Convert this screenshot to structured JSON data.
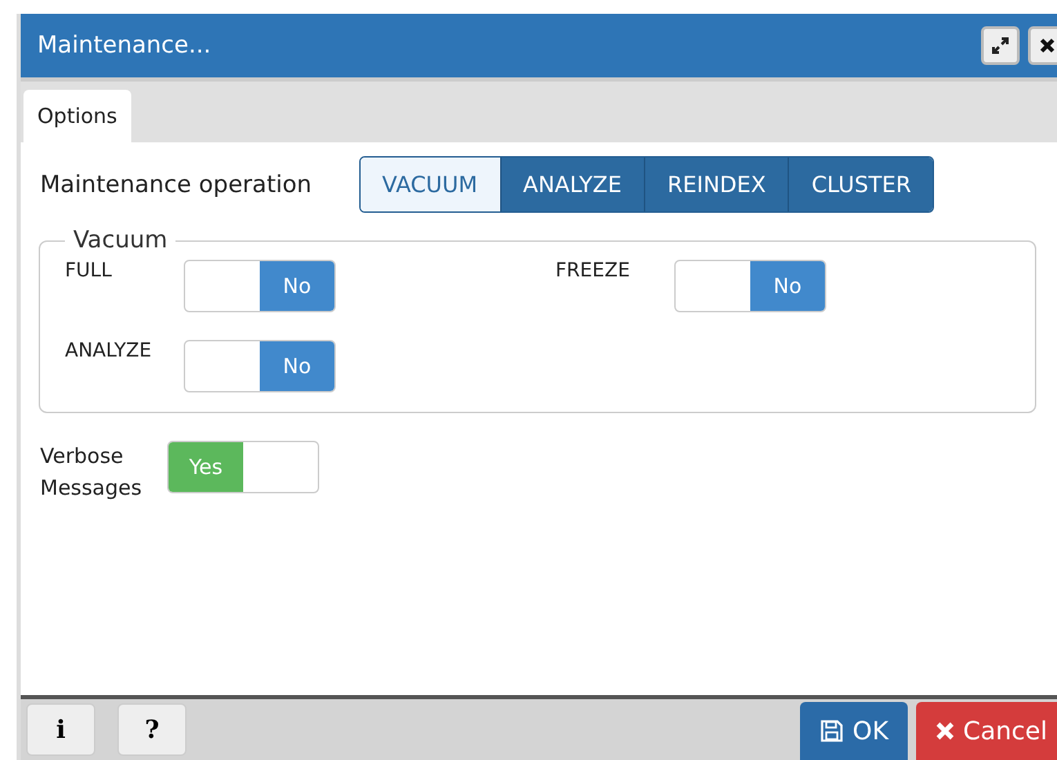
{
  "window": {
    "title": "Maintenance..."
  },
  "tabs": [
    {
      "label": "Options",
      "selected": true
    }
  ],
  "operation": {
    "label": "Maintenance operation",
    "options": [
      {
        "label": "VACUUM",
        "selected": true
      },
      {
        "label": "ANALYZE",
        "selected": false
      },
      {
        "label": "REINDEX",
        "selected": false
      },
      {
        "label": "CLUSTER",
        "selected": false
      }
    ]
  },
  "vacuum": {
    "legend": "Vacuum",
    "switches": [
      {
        "label": "FULL",
        "on": false,
        "text": "No"
      },
      {
        "label": "FREEZE",
        "on": false,
        "text": "No"
      },
      {
        "label": "ANALYZE",
        "on": false,
        "text": "No"
      }
    ]
  },
  "verbose": {
    "label": "Verbose Messages",
    "on": true,
    "text": "Yes"
  },
  "footer": {
    "info": "i",
    "help": "?",
    "ok": "OK",
    "cancel": "Cancel"
  }
}
